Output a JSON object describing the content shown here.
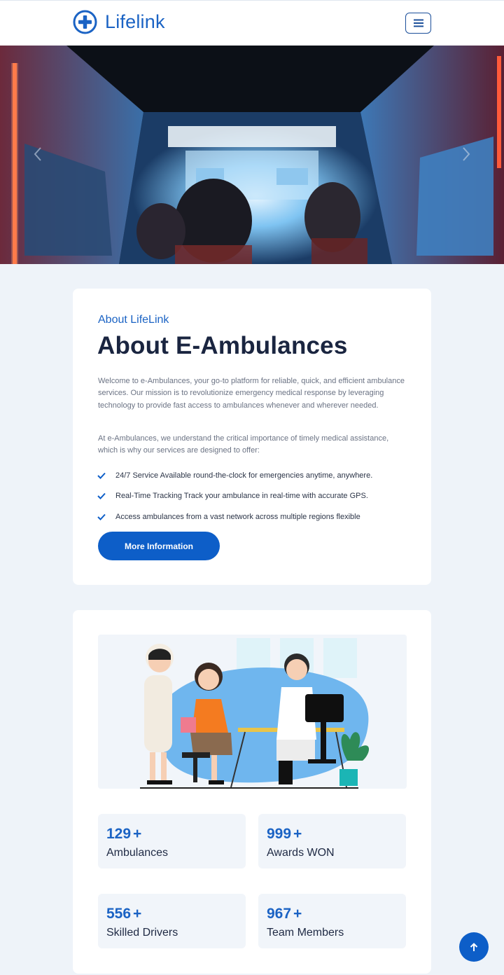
{
  "header": {
    "brand": "Lifelink",
    "menu_icon": "hamburger-icon",
    "brand_color": "#1b63c4"
  },
  "hero": {
    "image": "ambulance-interior-photo"
  },
  "about": {
    "subtitle": "About LifeLink",
    "title": "About E-Ambulances",
    "paragraph1": "Welcome to e-Ambulances, your go-to platform for reliable, quick, and efficient ambulance services. Our mission is to revolutionize emergency medical response by leveraging technology to provide fast access to ambulances whenever and wherever needed.",
    "paragraph2": "At e-Ambulances, we understand the critical importance of timely medical assistance, which is why our services are designed to offer:",
    "features": [
      "24/7 Service Available round-the-clock for emergencies anytime, anywhere.",
      "Real-Time Tracking Track your ambulance in real-time with accurate GPS.",
      "Access ambulances from a vast network across multiple regions flexible"
    ],
    "button": "More Information",
    "accent_color": "#0d5ec8"
  },
  "stats": {
    "illustration": "doctor-patient-consultation-illustration",
    "items": [
      {
        "value": "129",
        "suffix": "+",
        "label": "Ambulances"
      },
      {
        "value": "999",
        "suffix": "+",
        "label": "Awards WON"
      },
      {
        "value": "556",
        "suffix": "+",
        "label": "Skilled Drivers"
      },
      {
        "value": "967",
        "suffix": "+",
        "label": "Team Members"
      }
    ]
  },
  "back_to_top_icon": "arrow-up-icon"
}
